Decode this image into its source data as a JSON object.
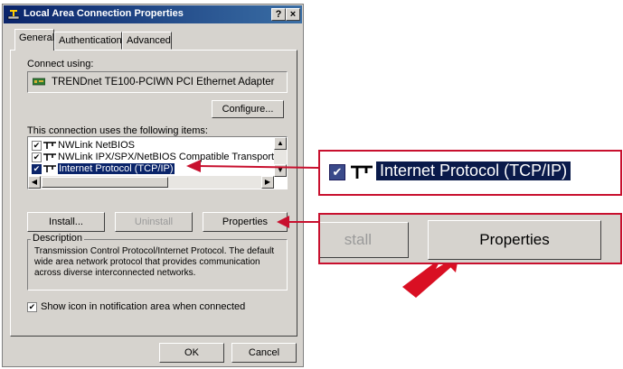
{
  "window": {
    "title": "Local Area Connection Properties",
    "help_btn": "?",
    "close_btn": "×"
  },
  "tabs": [
    {
      "label": "General",
      "active": true
    },
    {
      "label": "Authentication",
      "active": false
    },
    {
      "label": "Advanced",
      "active": false
    }
  ],
  "connect": {
    "label": "Connect using:",
    "adapter": "TRENDnet TE100-PCIWN PCI Ethernet Adapter",
    "configure_btn": "Configure..."
  },
  "items": {
    "label": "This connection uses the following items:",
    "list": [
      {
        "label": "NWLink NetBIOS",
        "checked": true,
        "selected": false
      },
      {
        "label": "NWLink IPX/SPX/NetBIOS Compatible Transport Proto",
        "checked": true,
        "selected": false
      },
      {
        "label": "Internet Protocol (TCP/IP)",
        "checked": true,
        "selected": true
      }
    ]
  },
  "buttons": {
    "install": "Install...",
    "uninstall": "Uninstall",
    "properties": "Properties"
  },
  "description": {
    "title": "Description",
    "text": "Transmission Control Protocol/Internet Protocol. The default wide area network protocol that provides communication across diverse interconnected networks."
  },
  "show_icon": {
    "label": "Show icon in notification area when connected",
    "checked": true
  },
  "footer": {
    "ok": "OK",
    "cancel": "Cancel"
  },
  "zoom": {
    "item_label": "Internet Protocol (TCP/IP)",
    "install_partial": "stall",
    "properties_label": "Properties"
  },
  "colors": {
    "annotation": "#c8102e",
    "selection": "#0a246a",
    "dialog_bg": "#d6d3ce"
  }
}
